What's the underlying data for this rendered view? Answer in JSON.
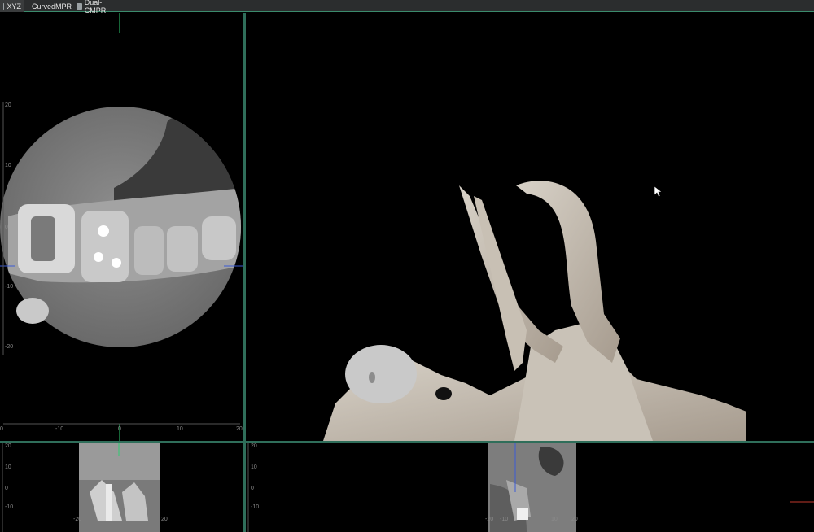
{
  "tabs": [
    {
      "label": "XYZ",
      "icon": "grid-icon",
      "active": true
    },
    {
      "label": "CurvedMPR",
      "icon": "curved-mpr-icon",
      "active": false
    },
    {
      "label": "Dual-CMPR",
      "icon": "dual-cmpr-icon",
      "active": false
    }
  ],
  "axial": {
    "y_ticks": [
      "20",
      "10",
      "0",
      "-10",
      "-20"
    ],
    "x_ticks": [
      "0",
      "-10",
      "0",
      "10",
      "20"
    ]
  },
  "coronal": {
    "y_ticks": [
      "20",
      "10",
      "0",
      "-10"
    ],
    "x_ticks": [
      "-20",
      "20"
    ]
  },
  "sagittal": {
    "y_ticks": [
      "20",
      "10",
      "0",
      "-10"
    ],
    "x_ticks": [
      "-20",
      "-10",
      "10",
      "20"
    ]
  },
  "colors": {
    "accent_green": "#3b8b6c",
    "crosshair_green": "#2ecc71",
    "crosshair_blue": "#3b5bd6",
    "crosshair_red": "#c0392b"
  }
}
